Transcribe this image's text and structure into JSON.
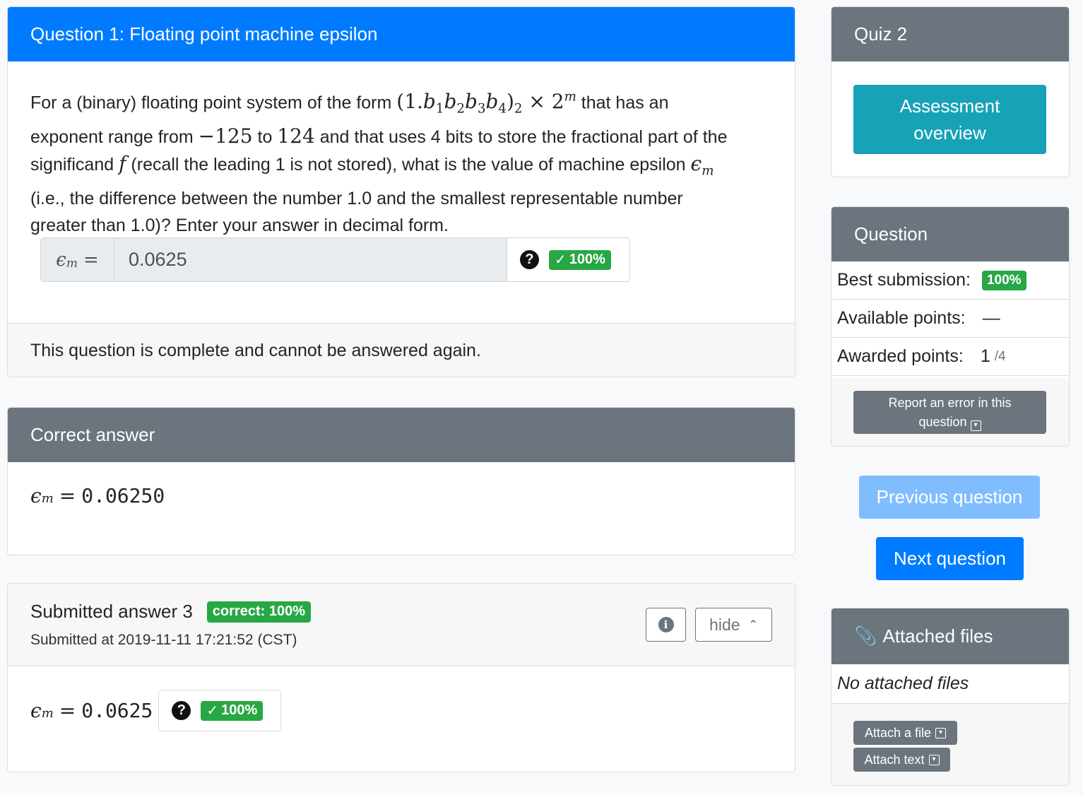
{
  "question": {
    "title": "Question 1: Floating point machine epsilon",
    "text_intro": "For a (binary) floating point system of the form",
    "text_form_after": "that has an",
    "text_line2_pre": "exponent range from",
    "exp_min": "−125",
    "to_word": "to",
    "exp_max": "124",
    "text_line2_post": "and that uses 4 bits to store the fractional part of the",
    "text_line3_pre": "significand",
    "f_symbol": "f",
    "text_line3_post": "(recall the leading 1 is not stored), what is the value of machine epsilon",
    "text_line4": "(i.e., the difference between the number 1.0 and the smallest representable number",
    "text_line5": "greater than 1.0)? Enter your answer in decimal form.",
    "input_label": "= ",
    "input_value": "0.0625",
    "help_icon": "?",
    "score_badge": "100%",
    "complete_text": "This question is complete and cannot be answered again."
  },
  "correct": {
    "header": "Correct answer",
    "value": "0.06250"
  },
  "submitted": {
    "title": "Submitted answer 3",
    "badge": "correct: 100%",
    "timestamp": "Submitted at 2019-11-11 17:21:52 (CST)",
    "info_icon": "i",
    "hide_label": "hide",
    "value": "0.0625",
    "help_icon": "?",
    "score_badge": "100%"
  },
  "quiz": {
    "header": "Quiz 2",
    "overview_button": "Assessment overview"
  },
  "question_panel": {
    "header": "Question",
    "best_label": "Best submission:",
    "best_value": "100%",
    "available_label": "Available points:",
    "available_value": "—",
    "awarded_label": "Awarded points:",
    "awarded_value": "1",
    "awarded_max": "/4",
    "report_button": "Report an error in this question"
  },
  "nav": {
    "previous": "Previous question",
    "next": "Next question"
  },
  "files": {
    "header": "Attached files",
    "empty": "No attached files",
    "attach_file": "Attach a file",
    "attach_text": "Attach text"
  },
  "colors": {
    "primary": "#007bff",
    "secondary": "#6c757d",
    "success": "#28a745",
    "info": "#17a2b8",
    "primary_disabled": "#80bdff"
  }
}
